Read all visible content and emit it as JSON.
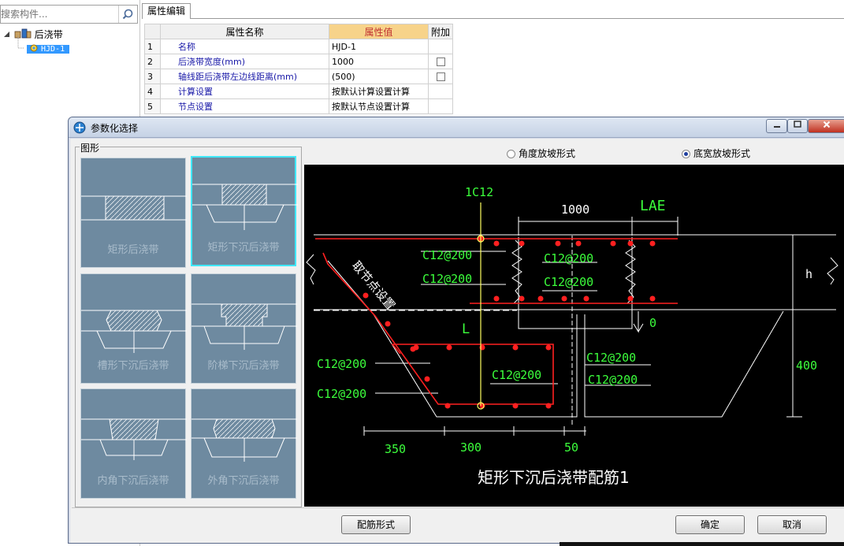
{
  "search": {
    "placeholder": "搜索构件..."
  },
  "tree": {
    "root_label": "后浇带",
    "child_label": "HJD-1"
  },
  "property_editor": {
    "tab_label": "属性编辑",
    "headers": {
      "name": "属性名称",
      "value": "属性值",
      "extra": "附加"
    },
    "rows": [
      {
        "num": "1",
        "name": "名称",
        "value": "HJD-1",
        "has_checkbox": false
      },
      {
        "num": "2",
        "name": "后浇带宽度(mm)",
        "value": "1000",
        "has_checkbox": true
      },
      {
        "num": "3",
        "name": "轴线距后浇带左边线距离(mm)",
        "value": "(500)",
        "has_checkbox": true
      },
      {
        "num": "4",
        "name": "计算设置",
        "value": "按默认计算设置计算",
        "has_checkbox": false
      },
      {
        "num": "5",
        "name": "节点设置",
        "value": "按默认节点设置计算",
        "has_checkbox": false
      }
    ]
  },
  "dialog": {
    "title": "参数化选择",
    "gallery_title": "图形",
    "thumbnails": [
      {
        "label": "矩形后浇带",
        "selected": false
      },
      {
        "label": "矩形下沉后浇带",
        "selected": true
      },
      {
        "label": "槽形下沉后浇带",
        "selected": false
      },
      {
        "label": "阶梯下沉后浇带",
        "selected": false
      },
      {
        "label": "内角下沉后浇带",
        "selected": false
      },
      {
        "label": "外角下沉后浇带",
        "selected": false
      }
    ],
    "radio_options": [
      {
        "label": "角度放坡形式",
        "checked": false
      },
      {
        "label": "底宽放坡形式",
        "checked": true
      }
    ],
    "drawing": {
      "title": "矩形下沉后浇带配筋1",
      "labels": {
        "top_bar": "1C12",
        "width": "1000",
        "lae": "LAE",
        "rebar_left_1": "C12@200",
        "rebar_left_2": "C12@200",
        "rebar_mid_1": "C12@200",
        "rebar_mid_2": "C12@200",
        "node_setting": "取节点设置",
        "h": "h",
        "zero": "0",
        "l": "L",
        "lower_left_1": "C12@200",
        "lower_left_2": "C12@200",
        "lower_mid": "C12@200",
        "lower_right_1": "C12@200",
        "lower_right_2": "C12@200",
        "depth": "400",
        "dim_350": "350",
        "dim_300": "300",
        "dim_50": "50"
      },
      "colors": {
        "line": "#ffffff",
        "rebar": "#ff2020",
        "text_green": "#3cff3c",
        "text_white": "#ffffff",
        "axis": "#ffff60"
      }
    },
    "buttons": {
      "rebar_form": "配筋形式",
      "ok": "确定",
      "cancel": "取消"
    }
  }
}
